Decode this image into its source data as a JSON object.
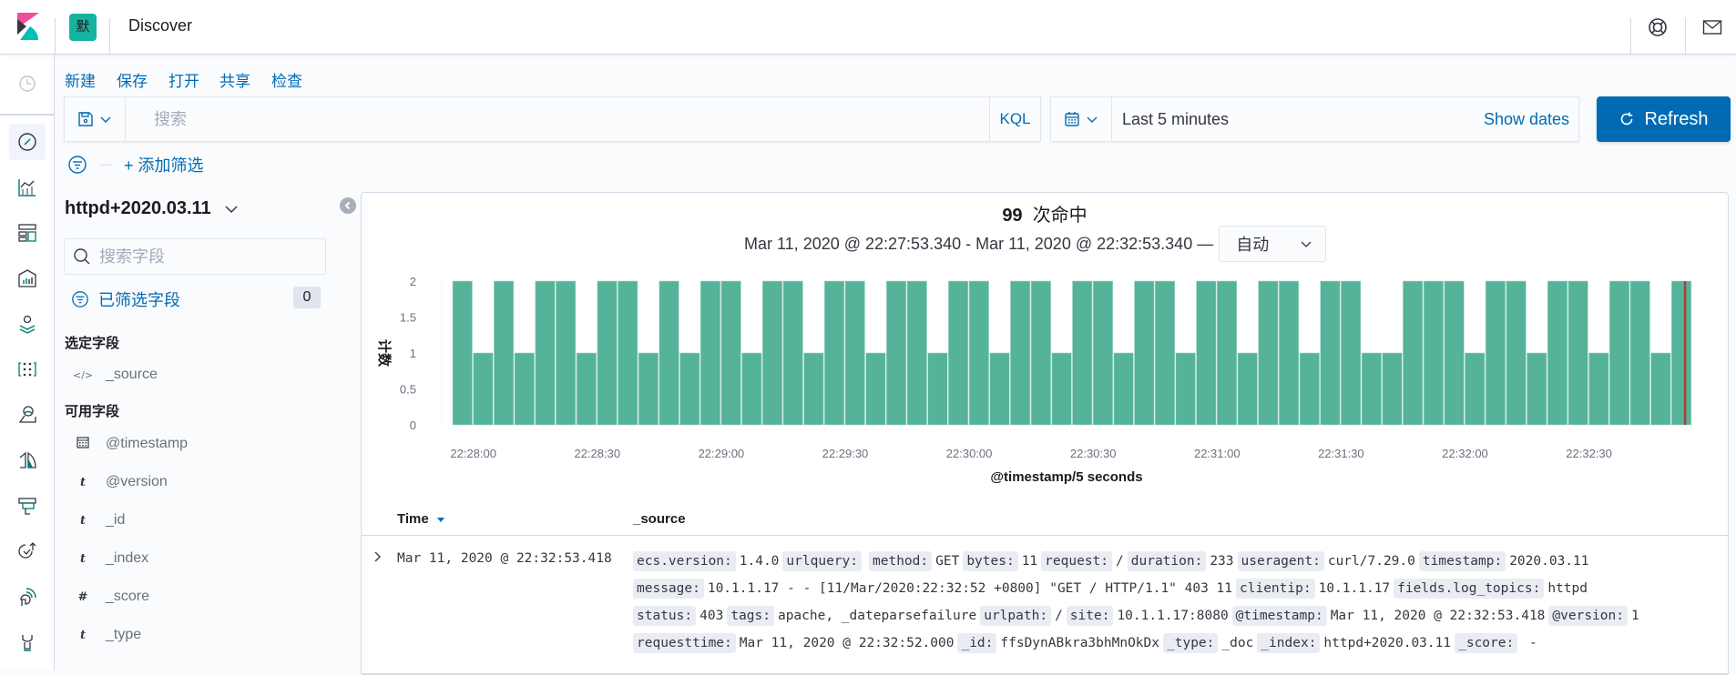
{
  "header": {
    "space_initial": "默",
    "app_title": "Discover",
    "icons": [
      "help-icon",
      "newsfeed-icon"
    ]
  },
  "nav": {
    "items": [
      "recently-viewed",
      "discover",
      "visualize",
      "dashboard",
      "canvas",
      "maps",
      "machine-learning",
      "infrastructure",
      "logs",
      "apm",
      "uptime",
      "siem",
      "dev-tools"
    ]
  },
  "toplinks": [
    "新建",
    "保存",
    "打开",
    "共享",
    "检查"
  ],
  "query": {
    "placeholder": "搜索",
    "value": "",
    "language": "KQL"
  },
  "time": {
    "label": "Last 5 minutes",
    "show_dates": "Show dates",
    "refresh": "Refresh"
  },
  "filters": {
    "add_label": "+ 添加筛选"
  },
  "sidebar": {
    "index_pattern": "httpd+2020.03.11",
    "field_search_placeholder": "搜索字段",
    "filtered_fields_label": "已筛选字段",
    "filtered_count": "0",
    "selected_title": "选定字段",
    "selected_fields": [
      {
        "type": "</>",
        "name": "_source"
      }
    ],
    "available_title": "可用字段",
    "available_fields": [
      {
        "type": "date",
        "name": "@timestamp"
      },
      {
        "type": "t",
        "name": "@version"
      },
      {
        "type": "t",
        "name": "_id"
      },
      {
        "type": "t",
        "name": "_index"
      },
      {
        "type": "#",
        "name": "_score"
      },
      {
        "type": "t",
        "name": "_type"
      }
    ]
  },
  "main": {
    "hits_count": "99",
    "hits_label": "次命中",
    "range_text": "Mar 11, 2020 @ 22:27:53.340 - Mar 11, 2020 @ 22:32:53.340 —",
    "interval": "自动"
  },
  "chart_data": {
    "type": "bar",
    "title": "",
    "xlabel": "@timestamp/5 seconds",
    "ylabel": "计数",
    "ylim": [
      0,
      2
    ],
    "yticks": [
      "0",
      "0.5",
      "1",
      "1.5",
      "2"
    ],
    "xtick_labels": [
      "22:28:00",
      "22:28:30",
      "22:29:00",
      "22:29:30",
      "22:30:00",
      "22:30:30",
      "22:31:00",
      "22:31:30",
      "22:32:00",
      "22:32:30"
    ],
    "bucket_start": "22:27:55",
    "bucket_seconds": 5,
    "values": [
      2,
      1,
      2,
      1,
      2,
      2,
      1,
      2,
      2,
      1,
      2,
      1,
      2,
      2,
      1,
      2,
      2,
      1,
      2,
      2,
      1,
      2,
      2,
      1,
      2,
      2,
      1,
      2,
      2,
      1,
      2,
      2,
      1,
      2,
      2,
      1,
      2,
      2,
      1,
      2,
      2,
      1,
      2,
      2,
      1,
      1,
      2,
      2,
      2,
      1,
      2,
      2,
      1,
      2,
      2,
      1,
      2,
      2,
      1,
      2
    ],
    "bar_color": "#54b399",
    "now_marker_color": "#bd271e",
    "grid": false,
    "legend": "none"
  },
  "table": {
    "columns": [
      "Time",
      "_source"
    ],
    "rows": [
      {
        "time": "Mar 11, 2020 @ 22:32:53.418",
        "source_lines": [
          [
            [
              "ecs.version:",
              "1.4.0"
            ],
            [
              "urlquery:",
              ""
            ],
            [
              "method:",
              "GET"
            ],
            [
              "bytes:",
              "11"
            ],
            [
              "request:",
              "/"
            ],
            [
              "duration:",
              "233"
            ],
            [
              "useragent:",
              "curl/7.29.0"
            ],
            [
              "timestamp:",
              "2020.03.11"
            ]
          ],
          [
            [
              "message:",
              "10.1.1.17 - - [11/Mar/2020:22:32:52 +0800] \"GET / HTTP/1.1\" 403 11"
            ],
            [
              "clientip:",
              "10.1.1.17"
            ],
            [
              "fields.log_topics:",
              "httpd"
            ]
          ],
          [
            [
              "status:",
              "403"
            ],
            [
              "tags:",
              "apache, _dateparsefailure"
            ],
            [
              "urlpath:",
              "/"
            ],
            [
              "site:",
              "10.1.1.17:8080"
            ],
            [
              "@timestamp:",
              "Mar 11, 2020 @ 22:32:53.418"
            ],
            [
              "@version:",
              "1"
            ]
          ],
          [
            [
              "requesttime:",
              "Mar 11, 2020 @ 22:32:52.000"
            ],
            [
              "_id:",
              "ffsDynABkra3bhMnOkDx"
            ],
            [
              "_type:",
              "_doc"
            ],
            [
              "_index:",
              "httpd+2020.03.11"
            ],
            [
              "_score:",
              " -"
            ]
          ]
        ]
      }
    ]
  },
  "colors": {
    "accent": "#006bb4",
    "bar": "#54b399",
    "space_badge": "#15b3a0"
  }
}
